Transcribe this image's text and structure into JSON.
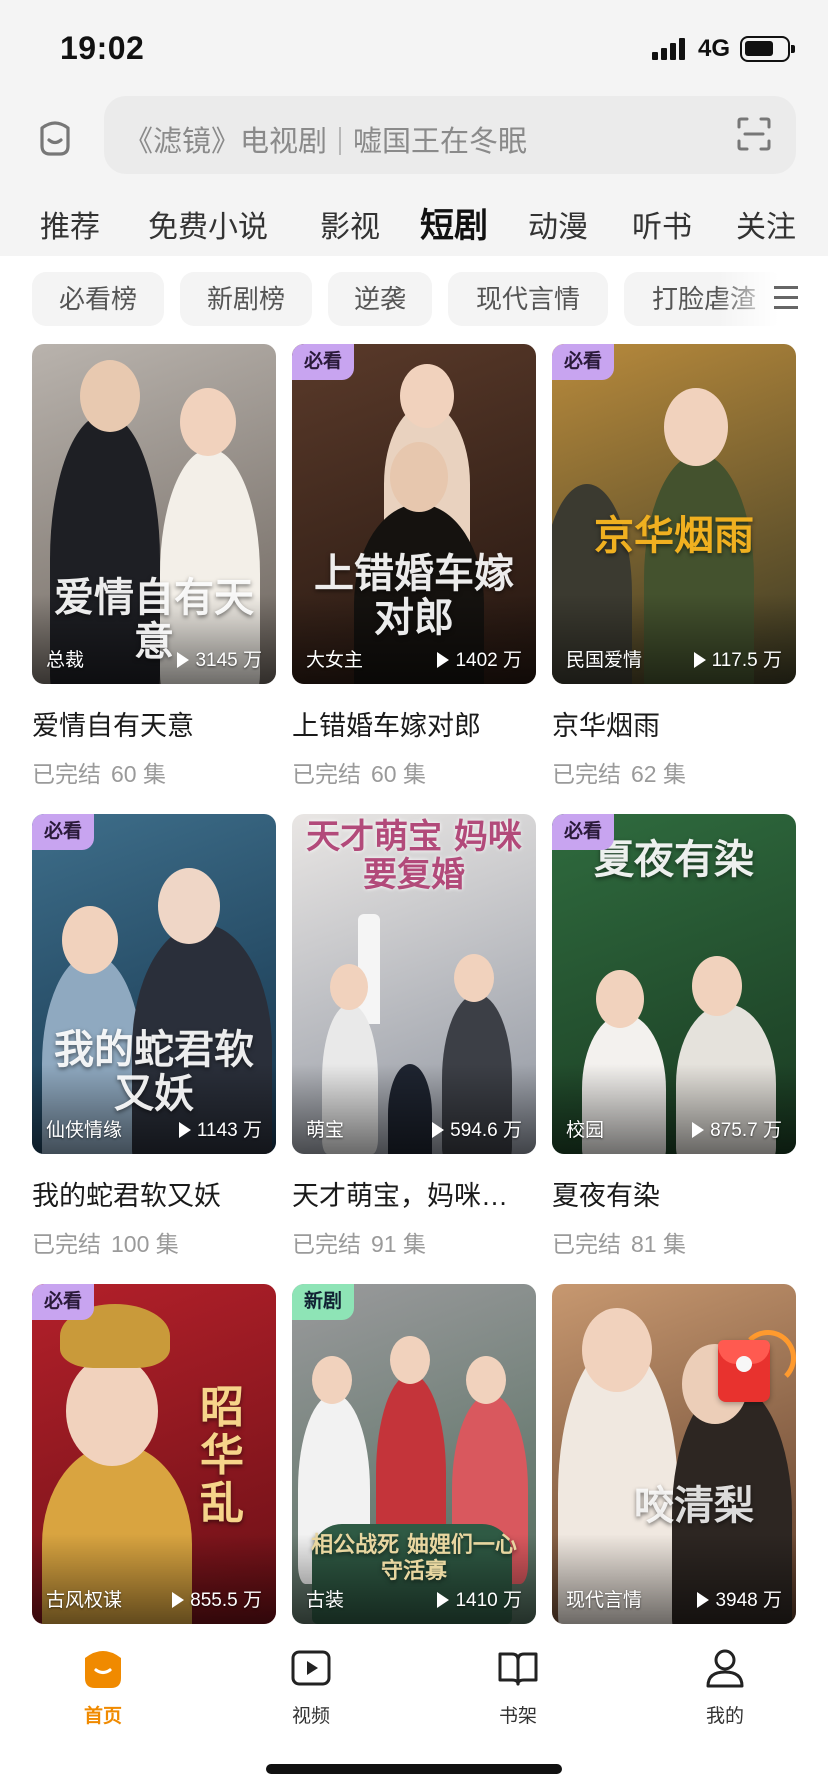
{
  "status_bar": {
    "time": "19:02",
    "network": "4G"
  },
  "search": {
    "placeholder_left": "《滤镜》电视剧",
    "placeholder_right": "嘘国王在冬眠"
  },
  "main_tabs": [
    {
      "label": "推荐"
    },
    {
      "label": "免费小说"
    },
    {
      "label": "影视"
    },
    {
      "label": "短剧",
      "active": true
    },
    {
      "label": "动漫"
    },
    {
      "label": "听书"
    },
    {
      "label": "关注"
    }
  ],
  "chips": [
    {
      "label": "必看榜"
    },
    {
      "label": "新剧榜"
    },
    {
      "label": "逆袭"
    },
    {
      "label": "现代言情"
    },
    {
      "label": "打脸虐渣"
    }
  ],
  "cards": [
    {
      "title": "爱情自有天意",
      "status": "已完结",
      "episodes": "60 集",
      "genre": "总裁",
      "views": "3145 万",
      "badge": "",
      "art": "爱情自有天意",
      "colors": [
        "#b9b3ad",
        "#6d655e"
      ]
    },
    {
      "title": "上错婚车嫁对郎",
      "status": "已完结",
      "episodes": "60 集",
      "genre": "大女主",
      "views": "1402 万",
      "badge": "必看",
      "art": "上错婚车嫁对郎",
      "colors": [
        "#5a3a2a",
        "#241610"
      ]
    },
    {
      "title": "京华烟雨",
      "status": "已完结",
      "episodes": "62 集",
      "genre": "民国爱情",
      "views": "117.5 万",
      "badge": "必看",
      "art": "京华烟雨",
      "colors": [
        "#b88a3c",
        "#3b3a24"
      ]
    },
    {
      "title": "我的蛇君软又妖",
      "status": "已完结",
      "episodes": "100 集",
      "genre": "仙侠情缘",
      "views": "1143 万",
      "badge": "必看",
      "art": "我的蛇君软又妖",
      "colors": [
        "#3e6e8a",
        "#14324a"
      ]
    },
    {
      "title": "天才萌宝，妈咪…",
      "status": "已完结",
      "episodes": "91 集",
      "genre": "萌宝",
      "views": "594.6 万",
      "badge": "",
      "art": "天才萌宝 妈咪要复婚",
      "colors": [
        "#e9e6e4",
        "#8f95a0"
      ]
    },
    {
      "title": "夏夜有染",
      "status": "已完结",
      "episodes": "81 集",
      "genre": "校园",
      "views": "875.7 万",
      "badge": "必看",
      "art": "夏夜有染",
      "colors": [
        "#2f6b3e",
        "#1a3a22"
      ]
    },
    {
      "title": "",
      "status": "",
      "episodes": "",
      "genre": "古风权谋",
      "views": "855.5 万",
      "badge": "必看",
      "art": "昭华乱",
      "colors": [
        "#b3202a",
        "#6a1016"
      ]
    },
    {
      "title": "",
      "status": "",
      "episodes": "",
      "genre": "古装",
      "views": "1410 万",
      "badge": "新剧",
      "art": "相公战死 妯娌们一心守活寡",
      "colors": [
        "#9a9a9c",
        "#4e6a5a"
      ]
    },
    {
      "title": "",
      "status": "",
      "episodes": "",
      "genre": "现代言情",
      "views": "3948 万",
      "badge": "",
      "art": "咬清梨",
      "colors": [
        "#c79870",
        "#5a3a28"
      ]
    }
  ],
  "bottom_nav": [
    {
      "label": "首页",
      "icon": "home-icon",
      "active": true
    },
    {
      "label": "视频",
      "icon": "video-icon"
    },
    {
      "label": "书架",
      "icon": "bookshelf-icon"
    },
    {
      "label": "我的",
      "icon": "profile-icon"
    }
  ],
  "colors": {
    "accent": "#f08a00",
    "badge_must": "#c8a4f0",
    "badge_new": "#8ee4b6"
  }
}
